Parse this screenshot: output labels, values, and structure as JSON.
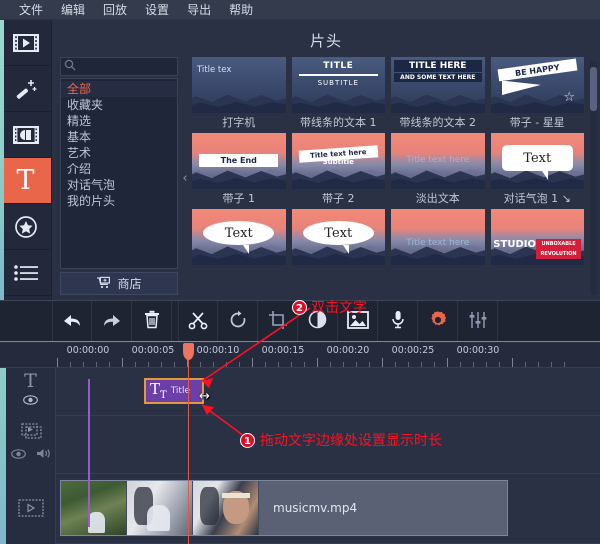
{
  "menubar": {
    "items": [
      {
        "label": "文件",
        "name": "menu-file"
      },
      {
        "label": "编辑",
        "name": "menu-edit"
      },
      {
        "label": "回放",
        "name": "menu-playback"
      },
      {
        "label": "设置",
        "name": "menu-settings"
      },
      {
        "label": "导出",
        "name": "menu-export"
      },
      {
        "label": "帮助",
        "name": "menu-help"
      }
    ]
  },
  "rail": {
    "items": [
      {
        "icon": "import-video-icon",
        "active": false
      },
      {
        "icon": "magic-wand-filters-icon",
        "active": false
      },
      {
        "icon": "transitions-icon",
        "active": false
      },
      {
        "icon": "titles-text-icon",
        "active": true,
        "glyph": "T"
      },
      {
        "icon": "stickers-star-icon",
        "active": false
      },
      {
        "icon": "list-menu-icon",
        "active": false
      }
    ]
  },
  "browser": {
    "title": "片头",
    "search": {
      "value": "",
      "placeholder": ""
    },
    "clear_label": "✕",
    "collapse_arrow": "‹",
    "categories": [
      {
        "label": "全部",
        "selected": true
      },
      {
        "label": "收藏夹",
        "selected": false
      },
      {
        "label": "精选",
        "selected": false
      },
      {
        "label": "基本",
        "selected": false
      },
      {
        "label": "艺术",
        "selected": false
      },
      {
        "label": "介绍",
        "selected": false
      },
      {
        "label": "对话气泡",
        "selected": false
      },
      {
        "label": "我的片头",
        "selected": false
      }
    ],
    "store_label": "商店",
    "items": [
      {
        "caption": "打字机",
        "preview_text": "Title tex",
        "style": "typewriter"
      },
      {
        "caption": "带线条的文本 1",
        "preview_text": "TITLE",
        "preview_sub": "SUBTITLE",
        "style": "lines1"
      },
      {
        "caption": "带线条的文本 2",
        "preview_text": "TITLE HERE",
        "preview_sub": "AND SOME TEXT HERE",
        "style": "lines2"
      },
      {
        "caption": "带子 - 星星",
        "preview_text": "BE HAPPY",
        "style": "ribbon-star"
      },
      {
        "caption": "带子 1",
        "preview_text": "The End",
        "style": "ribbon1"
      },
      {
        "caption": "带子 2",
        "preview_text": "Title text here",
        "preview_sub": "Subtitle",
        "style": "ribbon2"
      },
      {
        "caption": "淡出文本",
        "preview_text": "Title text here",
        "style": "fade"
      },
      {
        "caption": "对话气泡 1 ↘",
        "preview_text": "Text",
        "style": "bubble"
      },
      {
        "caption": "",
        "preview_text": "Text",
        "style": "bubble-oval"
      },
      {
        "caption": "",
        "preview_text": "Text",
        "style": "bubble-oval2"
      },
      {
        "caption": "",
        "preview_text": "Title text here",
        "style": "fade2"
      },
      {
        "caption": "",
        "preview_text": "STUDIO",
        "preview_sub": "UNBOXABLE REVOLUTION",
        "style": "studio"
      }
    ]
  },
  "toolbar": {
    "buttons": [
      {
        "name": "undo-button",
        "icon": "undo-arrow-icon"
      },
      {
        "name": "redo-button",
        "icon": "redo-arrow-icon"
      },
      {
        "name": "delete-button",
        "icon": "trash-icon"
      },
      {
        "name": "split-button",
        "icon": "scissors-icon"
      },
      {
        "name": "rotate-button",
        "icon": "rotate-icon"
      },
      {
        "name": "crop-button",
        "icon": "crop-icon"
      },
      {
        "name": "color-adjust-button",
        "icon": "contrast-circle-icon"
      },
      {
        "name": "image-tools-button",
        "icon": "image-icon"
      },
      {
        "name": "audio-record-button",
        "icon": "microphone-icon"
      },
      {
        "name": "properties-button",
        "icon": "gear-icon"
      },
      {
        "name": "equalizer-button",
        "icon": "sliders-icon"
      }
    ]
  },
  "timeline": {
    "ruler_labels": [
      "00:00:00",
      "00:00:05",
      "00:00:10",
      "00:00:15",
      "00:00:20",
      "00:00:25",
      "00:00:30"
    ],
    "tracks": [
      {
        "name": "title-track",
        "icon": "title-T-icon",
        "has_eye": true,
        "has_speaker": false
      },
      {
        "name": "overlay-video-track",
        "icon": "overlay-clips-icon",
        "has_eye": true,
        "has_speaker": true
      },
      {
        "name": "main-video-track",
        "icon": "filmstrip-icon",
        "has_eye": false,
        "has_speaker": false
      }
    ],
    "title_clip": {
      "glyph": "T",
      "glyph_sub": "T",
      "label": "Title"
    },
    "video_clip": {
      "filename": "musicmv.mp4"
    },
    "resize_cursor": "↔"
  },
  "annotations": [
    {
      "number": "2",
      "text": "双击文字",
      "name": "annotation-double-click-text"
    },
    {
      "number": "1",
      "text": "拖动文字边缘处设置显示时长",
      "name": "annotation-drag-edge-duration"
    }
  ],
  "colors": {
    "accent": "#e9664a",
    "annotation": "#ff1020",
    "playhead": "#e05a4a",
    "title_clip": "#6c3fa8"
  }
}
